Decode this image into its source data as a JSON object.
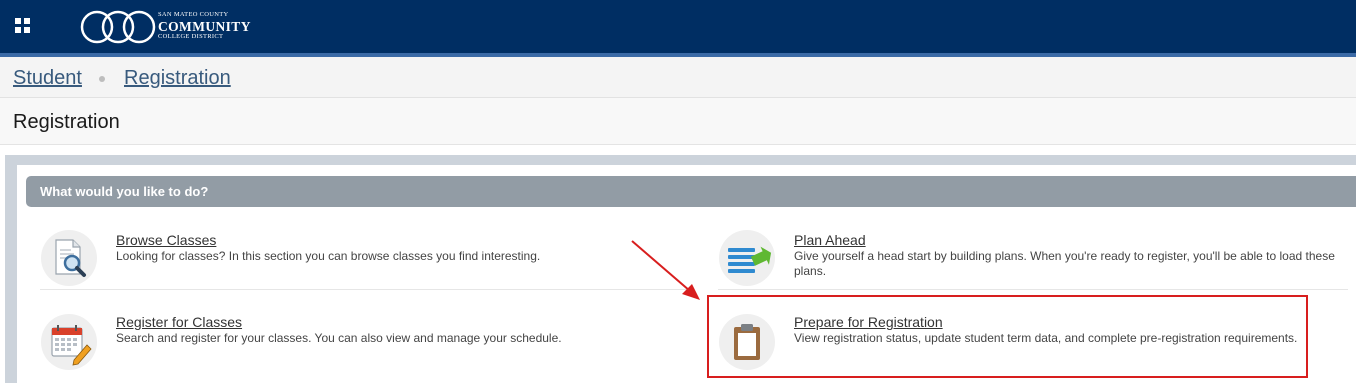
{
  "header": {
    "brand": {
      "line1": "SAN MATEO COUNTY",
      "line2": "COMMUNITY",
      "line3": "COLLEGE DISTRICT"
    }
  },
  "breadcrumb": {
    "items": [
      "Student",
      "Registration"
    ]
  },
  "page": {
    "title": "Registration"
  },
  "panel": {
    "heading": "What would you like to do?",
    "items": [
      {
        "title": "Browse Classes",
        "description": "Looking for classes? In this section you can browse classes you find interesting.",
        "icon": "browse-classes-icon"
      },
      {
        "title": "Plan Ahead",
        "description": "Give yourself a head start by building plans. When you're ready to register, you'll be able to load these plans.",
        "icon": "plan-ahead-icon"
      },
      {
        "title": "Register for Classes",
        "description": "Search and register for your classes. You can also view and manage your schedule.",
        "icon": "register-calendar-icon"
      },
      {
        "title": "Prepare for Registration",
        "description": "View registration status, update student term data, and complete pre-registration requirements.",
        "icon": "clipboard-icon"
      }
    ]
  },
  "colors": {
    "topbar": "#002e63",
    "panel_header": "#929ca5",
    "annotation": "#d81e1e"
  }
}
